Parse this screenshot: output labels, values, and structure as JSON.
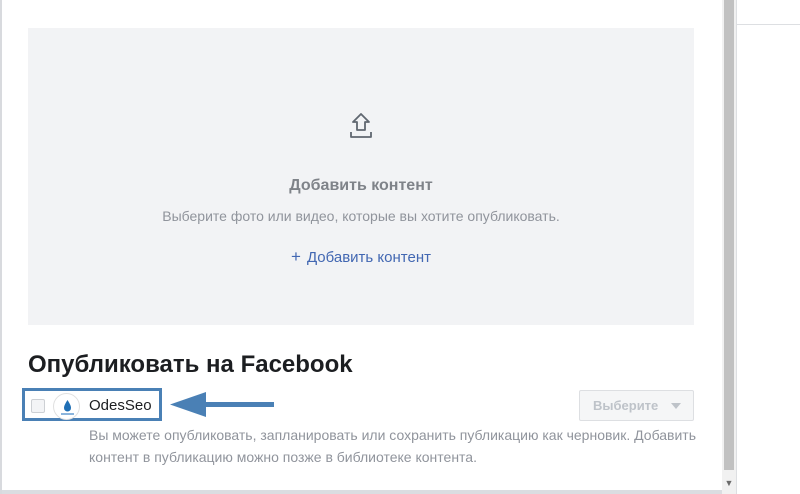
{
  "upload": {
    "icon": "upload-icon",
    "title": "Добавить контент",
    "description": "Выберите фото или видео, которые вы хотите опубликовать.",
    "link_label": "Добавить контент",
    "link_icon": "plus-icon"
  },
  "publish": {
    "title": "Опубликовать на Facebook",
    "page_name": "OdesSeo",
    "checked": false,
    "select_label": "Выберите",
    "help_text": "Вы можете опубликовать, запланировать или сохранить публикацию как черновик. Добавить контент в публикацию можно позже в библиотеке контента."
  },
  "colors": {
    "link": "#4267b2",
    "annotation": "#4a80b5"
  }
}
